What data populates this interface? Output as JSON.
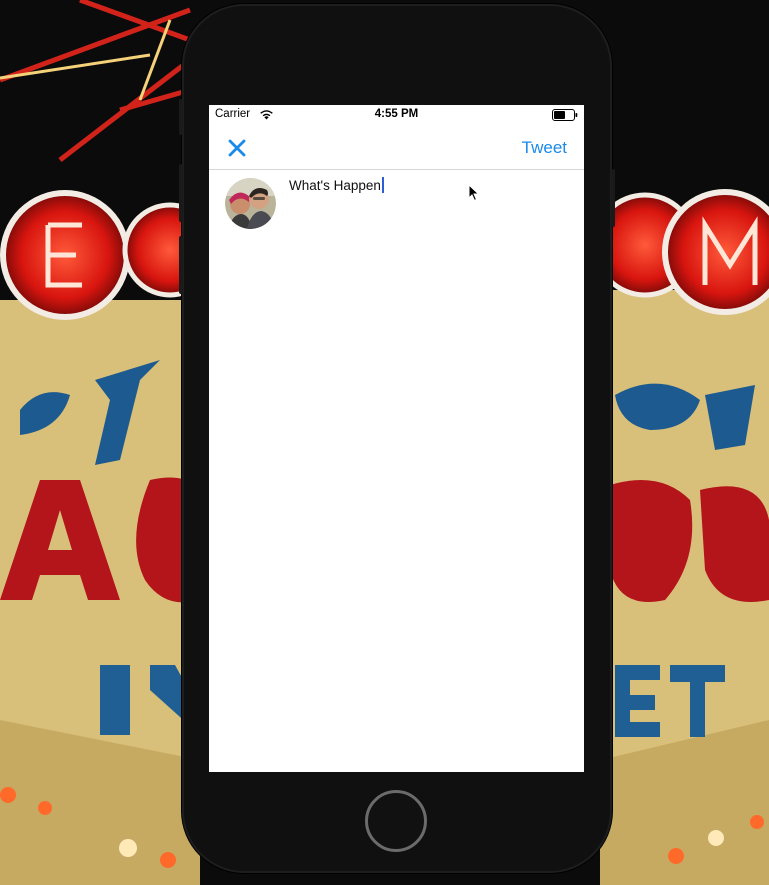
{
  "status_bar": {
    "carrier": "Carrier",
    "time": "4:55 PM",
    "wifi_icon": "wifi-icon",
    "battery_icon": "battery-icon"
  },
  "nav_bar": {
    "close_icon": "close-icon",
    "tweet_label": "Tweet",
    "accent_color": "#1a8ae8"
  },
  "composer": {
    "avatar": "user-avatar",
    "text_value": "What's Happen"
  },
  "device": {
    "home_button": "home-button"
  }
}
